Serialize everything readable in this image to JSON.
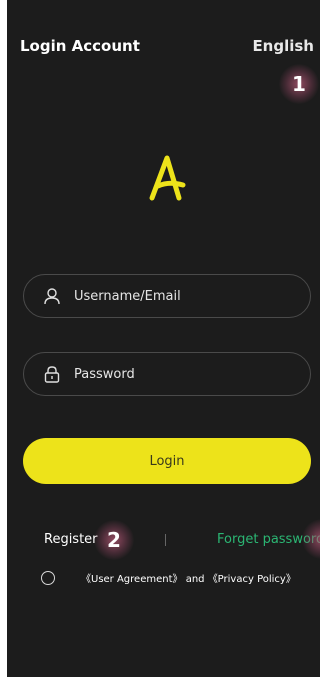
{
  "header": {
    "title": "Login Account",
    "language": "English"
  },
  "markers": {
    "m1": "1",
    "m2": "2"
  },
  "logo": {
    "icon": "letter-a-logo",
    "color": "#ede31a"
  },
  "form": {
    "username_placeholder": "Username/Email",
    "username_value": "",
    "password_placeholder": "Password",
    "password_value": "",
    "login_label": "Login"
  },
  "links": {
    "register": "Register",
    "forget": "Forget password"
  },
  "agreement": {
    "user_agreement": "《User Agreement》",
    "and": " and ",
    "privacy_policy": "《Privacy Policy》",
    "checked": false
  },
  "colors": {
    "background": "#1c1c1c",
    "accent": "#ede31a",
    "link_green": "#2bb673"
  }
}
